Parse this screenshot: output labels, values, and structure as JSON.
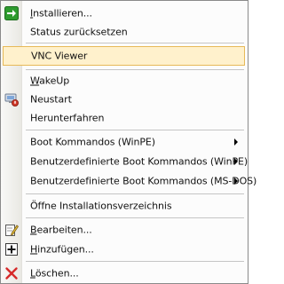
{
  "menu": {
    "items": [
      {
        "label": "Installieren...",
        "icon": "green-arrow-icon",
        "shortcut_letter": "I"
      },
      {
        "label": "Status zurücksetzen"
      },
      {
        "label": "VNC Viewer",
        "highlighted": true
      },
      {
        "label": "WakeUp",
        "shortcut_letter": "W"
      },
      {
        "label": "Neustart",
        "icon": "computer-restart-icon"
      },
      {
        "label": "Herunterfahren"
      },
      {
        "label": "Boot Kommandos (WinPE)",
        "submenu": true
      },
      {
        "label": "Benutzerdefinierte Boot Kommandos (WinPE)",
        "submenu": true
      },
      {
        "label": "Benutzerdefinierte Boot Kommandos (MS-DOS)",
        "submenu": true
      },
      {
        "label": "Öffne Installationsverzeichnis"
      },
      {
        "label": "Bearbeiten...",
        "icon": "edit-pencil-icon",
        "shortcut_letter": "B"
      },
      {
        "label": "Hinzufügen...",
        "icon": "add-plus-icon",
        "shortcut_letter": "H"
      },
      {
        "label": "Löschen...",
        "icon": "delete-x-icon",
        "shortcut_letter": "L"
      }
    ]
  },
  "colors": {
    "highlight_bg": "#fff1cc",
    "highlight_border": "#e7b958",
    "gutter": "#eeede8",
    "separator": "#c5c5c5"
  }
}
